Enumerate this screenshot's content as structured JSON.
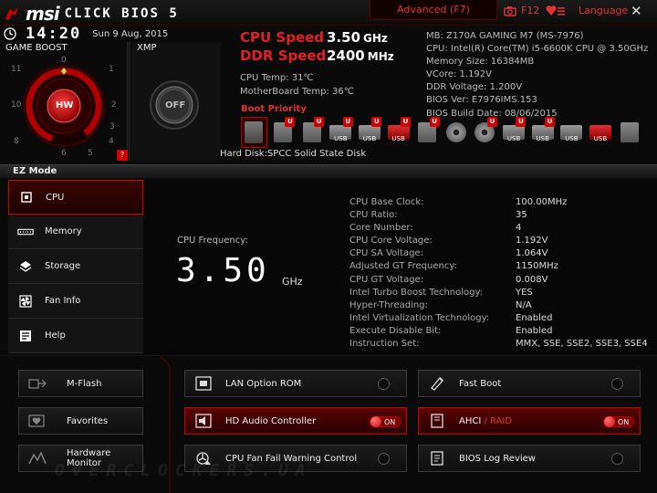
{
  "header": {
    "brand": "msi",
    "product": "CLICK BIOS 5",
    "advanced": "Advanced (F7)",
    "f12": "F12",
    "language": "Language",
    "close": "✕"
  },
  "clock": {
    "time": "14:20",
    "date": "Sun  9 Aug, 2015"
  },
  "game_boost": {
    "label": "GAME BOOST",
    "knob": "HW",
    "dial": [
      "0",
      "1",
      "2",
      "3",
      "4",
      "5",
      "6",
      "8",
      "10",
      "11"
    ],
    "help": "?"
  },
  "xmp": {
    "label": "XMP",
    "knob": "OFF"
  },
  "speeds": {
    "cpu_label": "CPU Speed",
    "cpu_value": "3.50",
    "cpu_unit": "GHz",
    "ddr_label": "DDR Speed",
    "ddr_value": "2400",
    "ddr_unit": "MHz",
    "cpu_temp": "CPU Temp: 31℃",
    "mb_temp": "MotherBoard Temp: 36℃"
  },
  "sysinfo": [
    "MB: Z170A GAMING M7 (MS-7976)",
    "CPU: Intel(R) Core(TM) i5-6600K CPU @ 3.50GHz",
    "Memory Size: 16384MB",
    "VCore: 1.192V",
    "DDR Voltage: 1.200V",
    "BIOS Ver: E7976IMS.153",
    "BIOS Build Date: 08/06/2015"
  ],
  "boot": {
    "label": "Boot Priority",
    "devices": [
      {
        "type": "hdd",
        "badge": "",
        "first": true
      },
      {
        "type": "box",
        "badge": "U"
      },
      {
        "type": "box",
        "badge": "U"
      },
      {
        "type": "usb",
        "badge": "U",
        "text": "USB"
      },
      {
        "type": "usb",
        "badge": "U",
        "text": "USB"
      },
      {
        "type": "usbred",
        "badge": "U",
        "text": "USB"
      },
      {
        "type": "box",
        "badge": "U"
      },
      {
        "type": "disc",
        "badge": ""
      },
      {
        "type": "disc",
        "badge": "U"
      },
      {
        "type": "usb",
        "badge": "U",
        "text": "USB"
      },
      {
        "type": "usb",
        "badge": "U",
        "text": "USB"
      },
      {
        "type": "usb",
        "badge": "",
        "text": "USB"
      },
      {
        "type": "usbred",
        "badge": "",
        "text": "USB"
      },
      {
        "type": "box",
        "badge": ""
      }
    ],
    "hard_disk": "Hard Disk:SPCC Solid State Disk"
  },
  "ez_mode": {
    "label": "EZ Mode"
  },
  "menu": [
    {
      "label": "CPU",
      "icon": "cpu-icon",
      "active": true
    },
    {
      "label": "Memory",
      "icon": "memory-icon"
    },
    {
      "label": "Storage",
      "icon": "storage-icon"
    },
    {
      "label": "Fan Info",
      "icon": "fan-icon"
    },
    {
      "label": "Help",
      "icon": "help-icon"
    }
  ],
  "cpu_panel": {
    "freq_label": "CPU Frequency:",
    "freq_value": "3.50",
    "freq_unit": "GHz",
    "specs": [
      [
        "CPU Base Clock:",
        "100.00MHz"
      ],
      [
        "CPU Ratio:",
        "35"
      ],
      [
        "Core Number:",
        "4"
      ],
      [
        "CPU Core Voltage:",
        "1.192V"
      ],
      [
        "CPU SA Voltage:",
        "1.064V"
      ],
      [
        "Adjusted GT Frequency:",
        "1150MHz"
      ],
      [
        "CPU GT Voltage:",
        "0.008V"
      ],
      [
        "Intel Turbo Boost Technology:",
        "YES"
      ],
      [
        "Hyper-Threading:",
        "N/A"
      ],
      [
        "Intel Virtualization Technology:",
        "Enabled"
      ],
      [
        "Execute Disable Bit:",
        "Enabled"
      ],
      [
        "Instruction Set:",
        "MMX, SSE, SSE2, SSE3, SSE4"
      ]
    ]
  },
  "bottom": {
    "left": [
      {
        "label": "M-Flash",
        "icon": "mflash-icon"
      },
      {
        "label": "Favorites",
        "icon": "favorites-icon"
      },
      {
        "label": "Hardware Monitor",
        "icon": "hardware-monitor-icon"
      }
    ],
    "options": [
      {
        "label": "LAN Option ROM",
        "icon": "lan-rom-icon",
        "on": false
      },
      {
        "label": "HD Audio Controller",
        "icon": "audio-icon",
        "on": true
      },
      {
        "label": "CPU Fan Fail Warning Control",
        "icon": "fan-warning-icon",
        "on": false
      },
      {
        "label": "Fast Boot",
        "icon": "fast-boot-icon",
        "on": false
      },
      {
        "label": "AHCI",
        "label2": " / RAID",
        "icon": "ahci-icon",
        "on": true
      },
      {
        "label": "BIOS Log Review",
        "icon": "bios-log-icon",
        "on": false
      }
    ],
    "on_text": "ON"
  },
  "watermark": "OVERCLOCKERS.UA",
  "colors": {
    "accent": "#e23333",
    "panel": "#141414",
    "background": "#0a0a0a"
  }
}
